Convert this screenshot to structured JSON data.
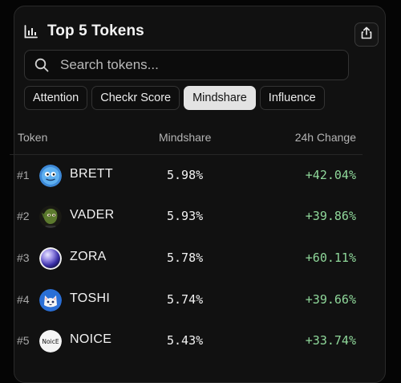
{
  "header": {
    "title": "Top 5 Tokens",
    "title_icon": "bar-chart-icon",
    "share_icon": "share-icon"
  },
  "search": {
    "placeholder": "Search tokens...",
    "icon": "search-icon"
  },
  "tabs": [
    {
      "label": "Attention",
      "active": false
    },
    {
      "label": "Checkr Score",
      "active": false
    },
    {
      "label": "Mindshare",
      "active": true
    },
    {
      "label": "Influence",
      "active": false
    }
  ],
  "table": {
    "headers": {
      "token": "Token",
      "mindshare": "Mindshare",
      "change": "24h Change"
    },
    "rows": [
      {
        "rank": "#1",
        "name": "BRETT",
        "mindshare": "5.98%",
        "change": "+42.04%",
        "logo": "brett-logo"
      },
      {
        "rank": "#2",
        "name": "VADER",
        "mindshare": "5.93%",
        "change": "+39.86%",
        "logo": "vader-logo"
      },
      {
        "rank": "#3",
        "name": "ZORA",
        "mindshare": "5.78%",
        "change": "+60.11%",
        "logo": "zora-logo"
      },
      {
        "rank": "#4",
        "name": "TOSHI",
        "mindshare": "5.74%",
        "change": "+39.66%",
        "logo": "toshi-logo"
      },
      {
        "rank": "#5",
        "name": "NOICE",
        "mindshare": "5.43%",
        "change": "+33.74%",
        "logo": "noice-logo",
        "logo_text": "NoicE"
      }
    ]
  },
  "colors": {
    "background": "#050505",
    "card": "#111111",
    "positive": "#8fd89a",
    "active_tab": "#e3e3e3"
  }
}
